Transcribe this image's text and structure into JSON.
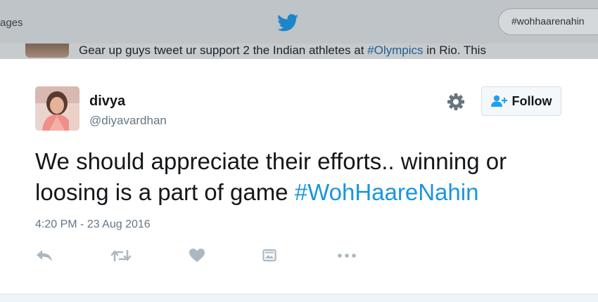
{
  "background": {
    "nav_messages_label": "ages",
    "search_value": "#wohhaarenahin",
    "prev_tweet_text": "Gear up guys tweet ur support 2 the Indian athletes at ",
    "prev_tweet_hashtag": "#Olympics",
    "prev_tweet_text_end": " in Rio. This"
  },
  "tweet": {
    "display_name": "divya",
    "handle": "@diyavardhan",
    "follow_label": "Follow",
    "text_part1": "We should appreciate their efforts.. winning or loosing is a part of game  ",
    "hashtag": "#WohHaareNahin",
    "timestamp": "4:20 PM - 23 Aug 2016"
  },
  "icons": {
    "bird": "twitter-bird-icon",
    "settings": "gear-icon",
    "follow": "add-user-icon",
    "reply": "reply-icon",
    "retweet": "retweet-icon",
    "like": "heart-icon",
    "moment": "moment-icon",
    "more": "more-dots-icon"
  },
  "colors": {
    "brand_blue": "#1da1f2",
    "hashtag": "#1b95e0",
    "action_icon": "#aab8c2",
    "muted_text": "#657786"
  }
}
